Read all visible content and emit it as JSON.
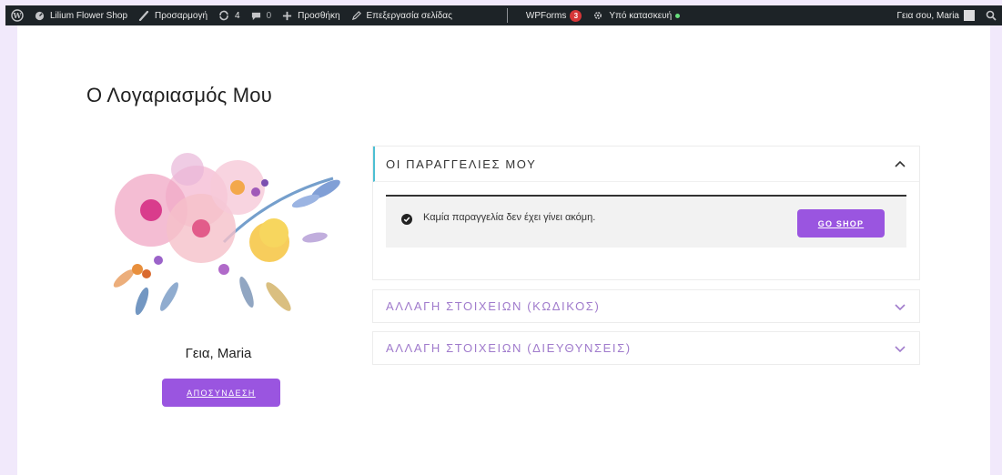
{
  "adminbar": {
    "site_name": "Lilium Flower Shop",
    "customize": "Προσαρμογή",
    "updates_count": "4",
    "comments_count": "0",
    "new": "Προσθήκη",
    "edit_page": "Επεξεργασία σελίδας",
    "wpforms": "WPForms",
    "wpforms_badge": "3",
    "maintenance": "Υπό κατασκευή",
    "greeting": "Γεια σου, Maria"
  },
  "page": {
    "title": "Ο Λογαριασμός Μου"
  },
  "profile": {
    "greeting": "Γεια, Maria",
    "logout_label": "ΑΠΟΣΥΝΔΕΣΗ"
  },
  "accordion": {
    "orders": {
      "title": "ΟΙ ΠΑΡΑΓΓΕΛΙΕΣ ΜΟΥ",
      "notice": "Καμία παραγγελία δεν έχει γίνει ακόμη.",
      "shop_button": "GO SHOP"
    },
    "password": {
      "title": "ΑΛΛΑΓΗ ΣΤΟΙΧΕΙΩΝ (ΚΩΔΙΚΟΣ)"
    },
    "addresses": {
      "title": "ΑΛΛΑΓΗ ΣΤΟΙΧΕΙΩΝ (ΔΙΕΥΘΥΝΣΕΙΣ)"
    }
  },
  "colors": {
    "accent": "#9a55e0",
    "frame": "#f1e9fb",
    "adminbar": "#1d2327",
    "active_border": "#4dbfd3"
  },
  "icons": {
    "wp": "wordpress-logo-icon",
    "site": "dashboard-icon",
    "customize": "brush-icon",
    "updates": "updates-icon",
    "comments": "comment-icon",
    "new": "plus-icon",
    "edit": "pencil-icon",
    "maintenance": "gear-icon",
    "search": "search-icon",
    "notice": "check-circle-icon",
    "expand": "chevron-down-icon",
    "collapse": "chevron-up-icon"
  }
}
